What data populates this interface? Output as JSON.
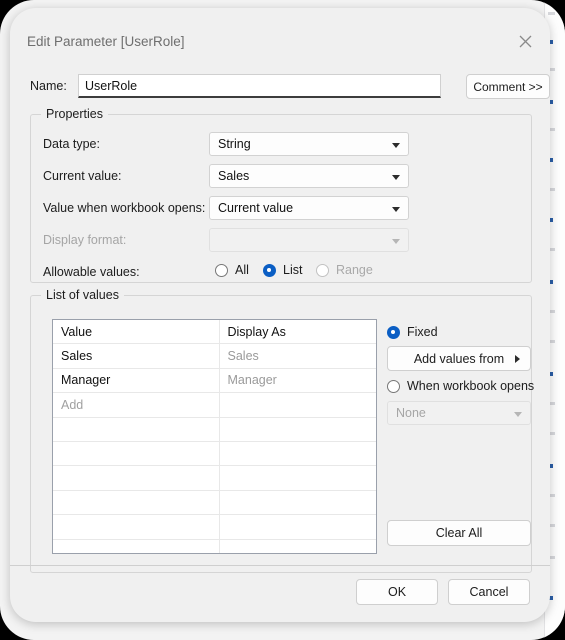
{
  "dialog": {
    "title": "Edit Parameter [UserRole]",
    "close_icon": "close-icon"
  },
  "name_row": {
    "label": "Name:",
    "value": "UserRole",
    "placeholder": "",
    "comment_button": "Comment >>"
  },
  "properties": {
    "group_title": "Properties",
    "data_type": {
      "label": "Data type:",
      "value": "String"
    },
    "current_value": {
      "label": "Current value:",
      "value": "Sales"
    },
    "value_on_open": {
      "label": "Value when workbook opens:",
      "value": "Current value"
    },
    "display_format": {
      "label": "Display format:",
      "value": "",
      "disabled": true
    },
    "allowable_values": {
      "label": "Allowable values:",
      "options": [
        {
          "label": "All",
          "selected": false,
          "disabled": false
        },
        {
          "label": "List",
          "selected": true,
          "disabled": false
        },
        {
          "label": "Range",
          "selected": false,
          "disabled": true
        }
      ]
    }
  },
  "list_of_values": {
    "group_title": "List of values",
    "columns": [
      "Value",
      "Display As"
    ],
    "rows": [
      {
        "value": "Sales",
        "display_as": "Sales"
      },
      {
        "value": "Manager",
        "display_as": "Manager"
      }
    ],
    "add_placeholder": "Add",
    "empty_row_count": 8,
    "source": {
      "fixed": {
        "label": "Fixed",
        "selected": true
      },
      "add_values_from": {
        "label": "Add values from",
        "caret": "caret-right-icon"
      },
      "when_workbook_opens": {
        "label": "When workbook opens",
        "selected": false
      },
      "when_workbook_opens_value": "None",
      "clear_all": "Clear All"
    }
  },
  "footer": {
    "ok": "OK",
    "cancel": "Cancel"
  },
  "colors": {
    "accent": "#0b5ec4",
    "dialog_bg": "#f0f0f0",
    "field_bg": "#ffffff",
    "text": "#1c1c1c",
    "muted": "#9a9a9a"
  }
}
